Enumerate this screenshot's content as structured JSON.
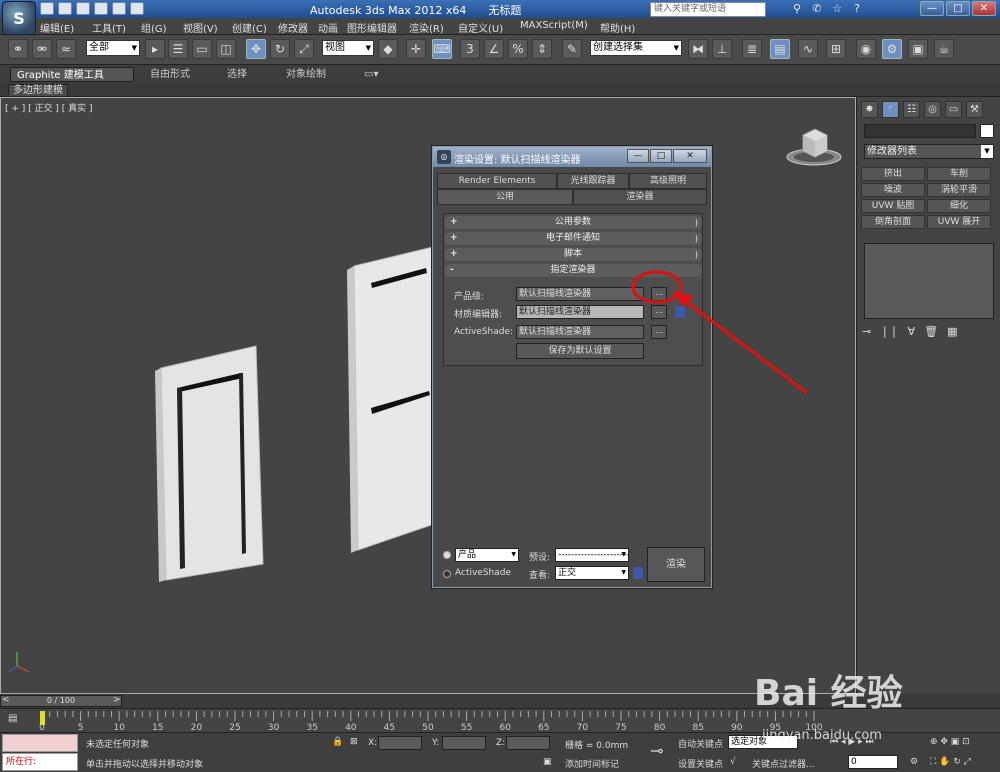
{
  "window": {
    "title": "Autodesk 3ds Max  2012 x64",
    "document": "无标题",
    "search_placeholder": "键入关键字或短语",
    "controls": [
      "—",
      "□",
      "✕"
    ]
  },
  "app_logo": "S",
  "menu": [
    "编辑(E)",
    "工具(T)",
    "组(G)",
    "视图(V)",
    "创建(C)",
    "修改器",
    "动画",
    "图形编辑器",
    "渲染(R)",
    "自定义(U)",
    "MAXScript(M)",
    "帮助(H)"
  ],
  "toolbar": {
    "selection_filter": "全部",
    "reference_coord": "视图",
    "named_selection": "创建选择集"
  },
  "ribbon": {
    "tabs": [
      "Graphite 建模工具",
      "自由形式",
      "选择",
      "对象绘制"
    ],
    "sub_tab": "多边形建模"
  },
  "viewport": {
    "label": "[ + ] [ 正交 ] [ 真实 ]"
  },
  "command_panel": {
    "modifier_list": "修改器列表",
    "buttons": [
      "挤出",
      "车削",
      "噪波",
      "涡轮平滑",
      "UVW 贴图",
      "细化",
      "倒角剖面",
      "UVW 展开"
    ]
  },
  "dialog": {
    "title": "渲染设置: 默认扫描线渲染器",
    "tabs_top": [
      "Render Elements",
      "光线跟踪器",
      "高级照明"
    ],
    "tabs_bottom": [
      "公用",
      "渲染器"
    ],
    "rollouts": [
      {
        "sign": "+",
        "label": "公用参数"
      },
      {
        "sign": "+",
        "label": "电子邮件通知"
      },
      {
        "sign": "+",
        "label": "脚本"
      },
      {
        "sign": "-",
        "label": "指定渲染器"
      }
    ],
    "assign": {
      "production_label": "产品级:",
      "production_value": "默认扫描线渲染器",
      "material_label": "材质编辑器:",
      "material_value": "默认扫描线渲染器",
      "activeshade_label": "ActiveShade:",
      "activeshade_value": "默认扫描线渲染器",
      "dots": "...",
      "save_default": "保存为默认设置"
    },
    "bottom": {
      "mode_production": "产品",
      "mode_activeshade": "ActiveShade",
      "preset_label": "预设:",
      "preset_value": "------------------------",
      "view_label": "查看:",
      "view_value": "正交",
      "render_button": "渲染"
    }
  },
  "timeline": {
    "slider": "0 / 100",
    "ticks": [
      "0",
      "5",
      "10",
      "15",
      "20",
      "25",
      "30",
      "35",
      "40",
      "45",
      "50",
      "55",
      "60",
      "65",
      "70",
      "75",
      "80",
      "85",
      "90",
      "95",
      "100"
    ]
  },
  "status": {
    "where": "所在行:",
    "selection": "未选定任何对象",
    "prompt": "单击并拖动以选择并移动对象",
    "x_label": "X:",
    "y_label": "Y:",
    "z_label": "Z:",
    "grid": "栅格 = 0.0mm",
    "add_time_tag": "添加时间标记",
    "auto_key": "自动关键点",
    "set_key": "设置关键点",
    "selected_object": "选定对象",
    "key_filters": "关键点过滤器...",
    "frame": "0"
  },
  "watermark": {
    "brand": "Bai 经验",
    "url": "jingyan.baidu.com"
  },
  "colors": {
    "annotation": "#e01010",
    "viewport_bg": "#444444",
    "door": "#e8e8e8"
  }
}
